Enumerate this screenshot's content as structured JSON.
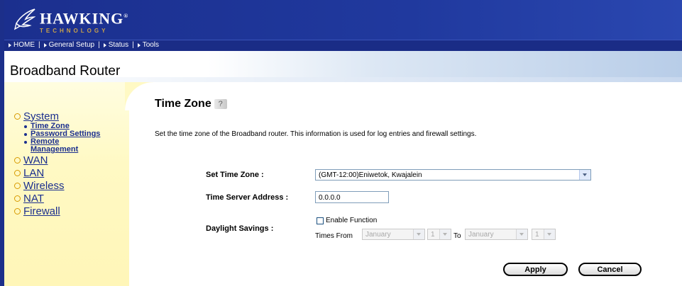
{
  "brand": {
    "name": "HAWKING",
    "sub": "TECHNOLOGY",
    "registered": "®"
  },
  "nav": {
    "items": [
      {
        "label": "HOME"
      },
      {
        "label": "General Setup"
      },
      {
        "label": "Status"
      },
      {
        "label": "Tools"
      }
    ]
  },
  "page_title": "Broadband Router",
  "sidebar": {
    "system": "System",
    "system_sub": [
      {
        "label": "Time Zone"
      },
      {
        "label": "Password Settings"
      },
      {
        "label": "Remote Management"
      }
    ],
    "menu": [
      {
        "label": "WAN"
      },
      {
        "label": "LAN"
      },
      {
        "label": "Wireless"
      },
      {
        "label": "NAT"
      },
      {
        "label": "Firewall"
      }
    ]
  },
  "content": {
    "title": "Time Zone",
    "help_icon": "?",
    "description": "Set the time zone of the Broadband router. This information is used for log entries and firewall settings.",
    "set_time_zone_label": "Set Time Zone :",
    "time_zone_value": "(GMT-12:00)Eniwetok, Kwajalein",
    "time_server_label": "Time Server Address :",
    "time_server_value": "0.0.0.0",
    "daylight_label": "Daylight Savings :",
    "enable_function_label": "Enable Function",
    "enable_function_checked": false,
    "times_from_label": "Times From",
    "from_month": "January",
    "from_day": "1",
    "to_label": "To",
    "to_month": "January",
    "to_day": "1",
    "apply_label": "Apply",
    "cancel_label": "Cancel"
  },
  "colors": {
    "header_blue": "#1b2f8e",
    "link_blue": "#1b2f8e",
    "sidebar_yellow": "#fff9c4",
    "bullet_orange": "#d79a00"
  }
}
